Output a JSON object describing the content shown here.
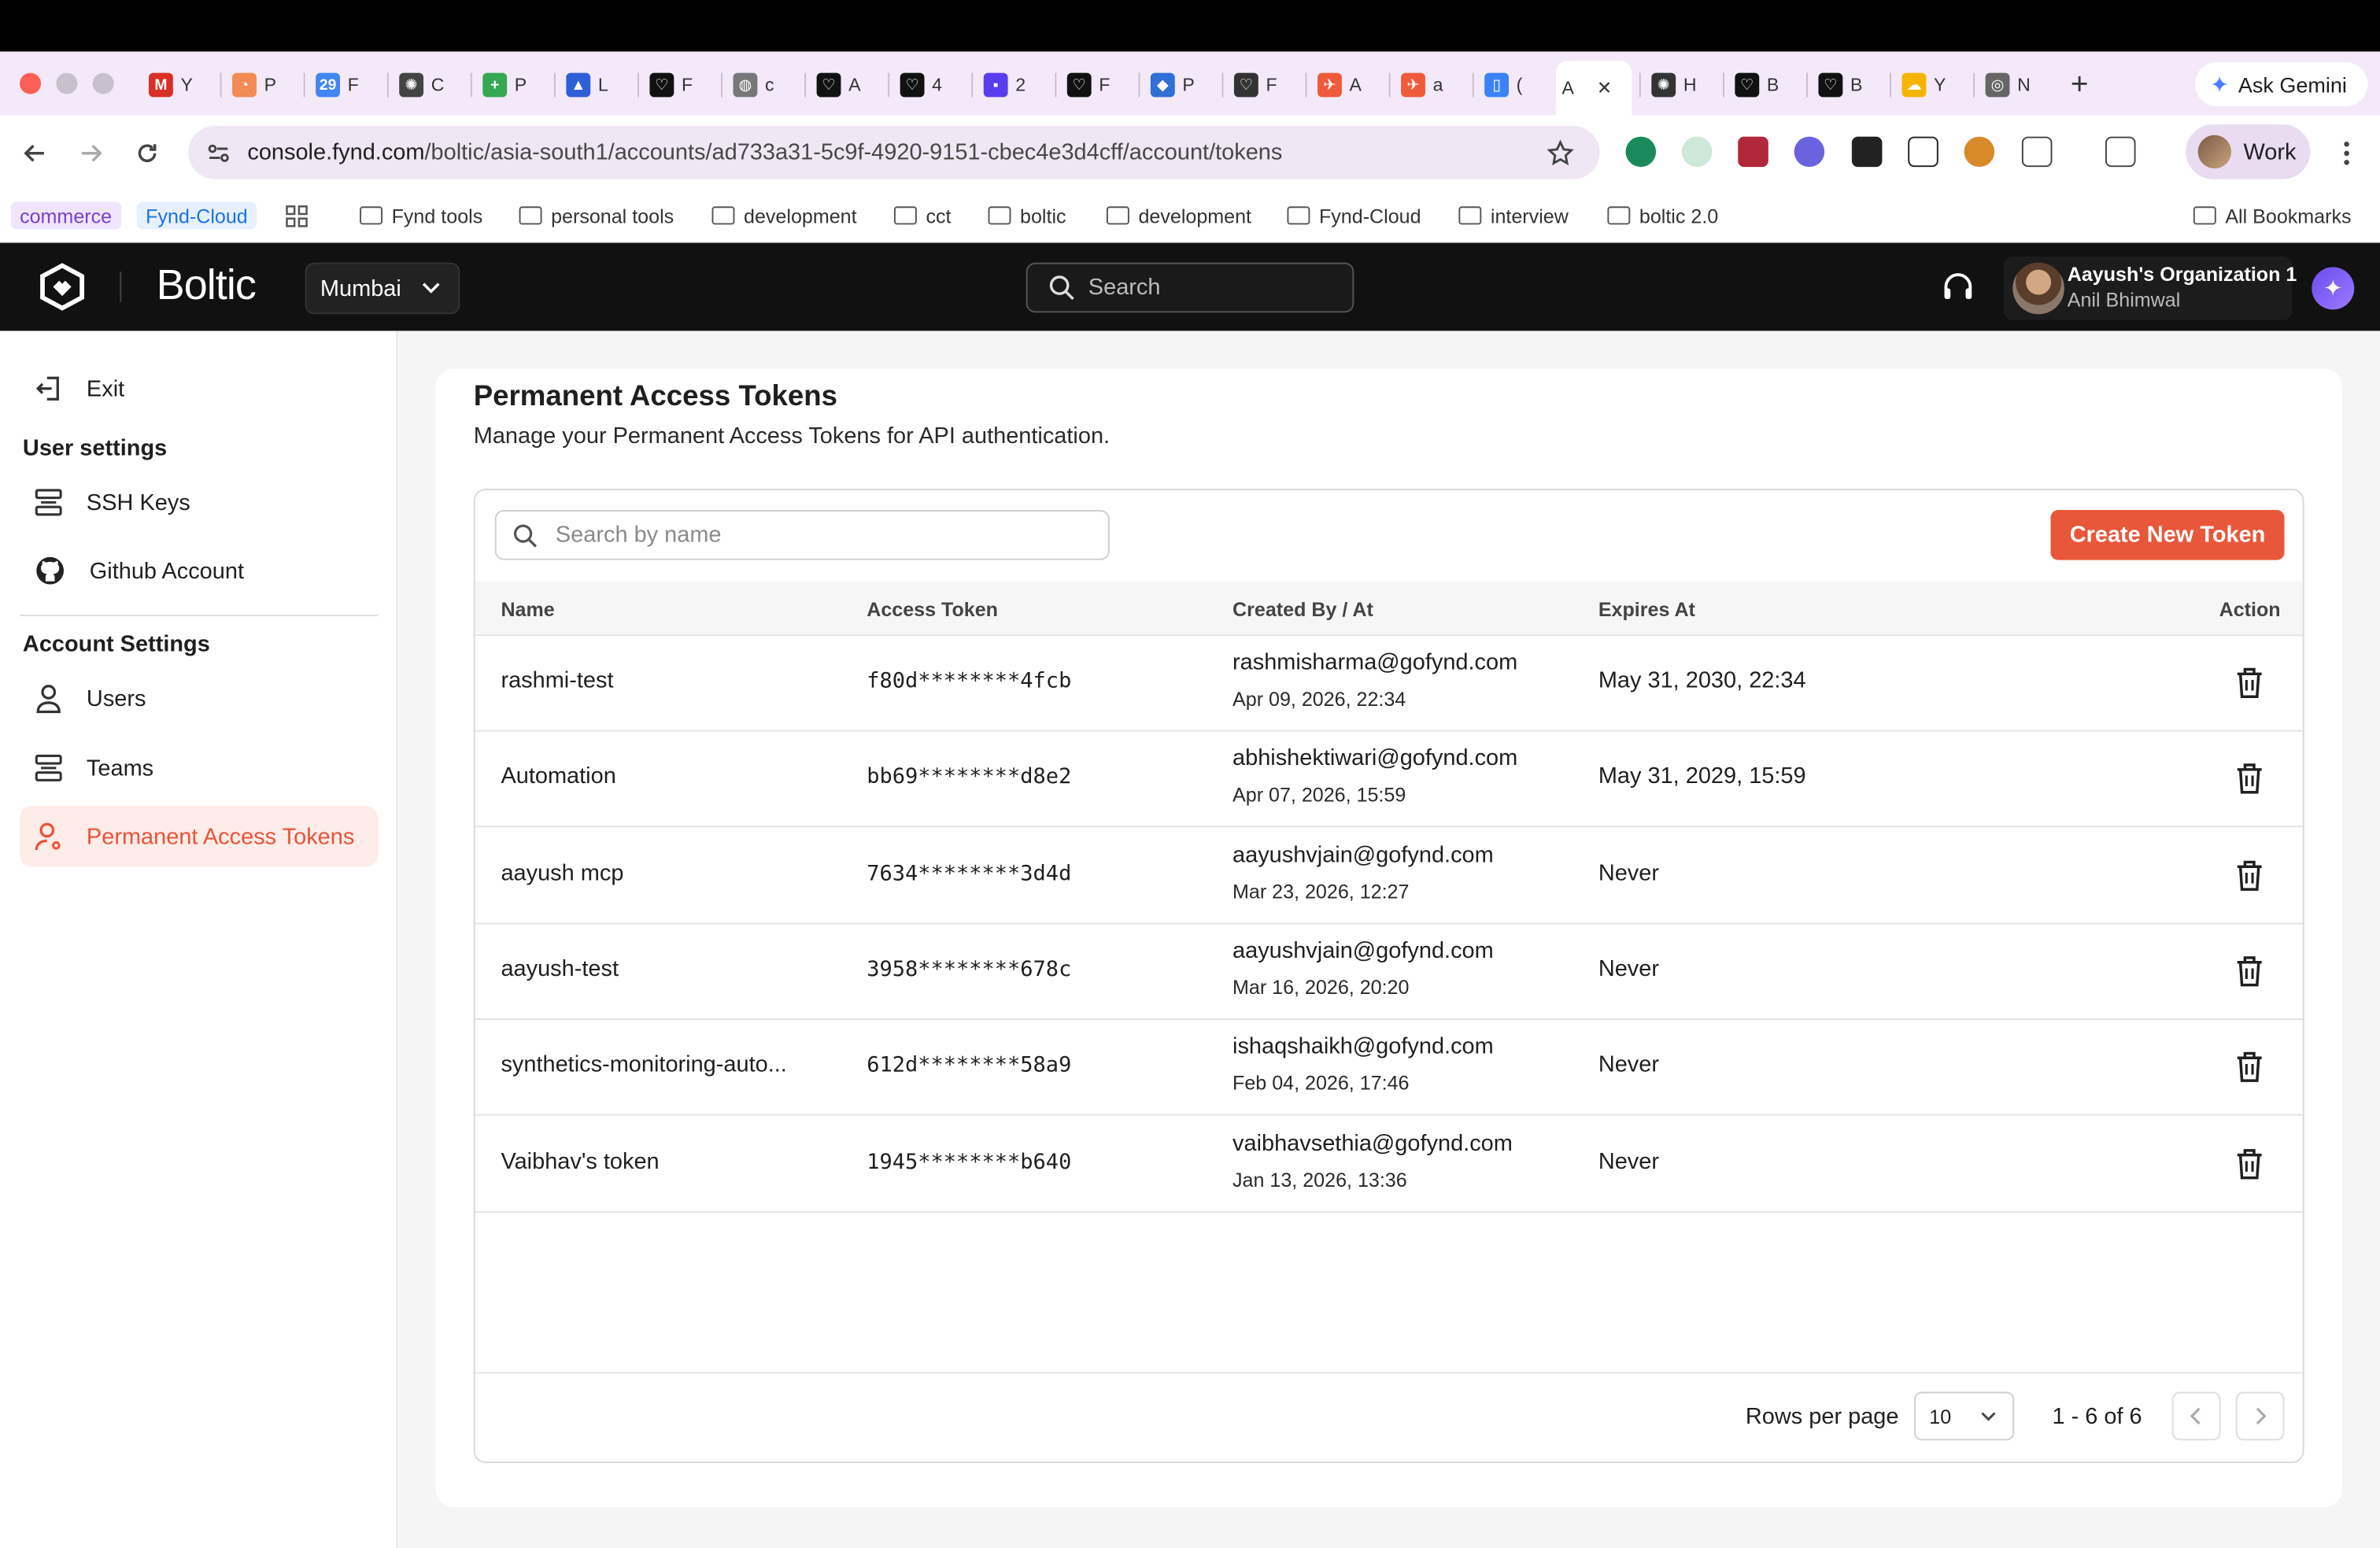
{
  "browser": {
    "tabs": [
      {
        "letter": "Y",
        "color": "#d93025",
        "icon": "gmail-icon",
        "glyph": "M"
      },
      {
        "letter": "P",
        "color": "#f28b54",
        "icon": "clock-icon",
        "glyph": "◔"
      },
      {
        "letter": "F",
        "color": "#4285f4",
        "icon": "calendar-icon",
        "glyph": "29"
      },
      {
        "letter": "C",
        "color": "#444444",
        "icon": "openai-icon",
        "glyph": "✺"
      },
      {
        "letter": "P",
        "color": "#34a853",
        "icon": "sheets-icon",
        "glyph": "+"
      },
      {
        "letter": "L",
        "color": "#2f5fd6",
        "icon": "atlassian-icon",
        "glyph": "▲"
      },
      {
        "letter": "F",
        "color": "#111111",
        "icon": "boltic-icon",
        "glyph": "♡"
      },
      {
        "letter": "c",
        "color": "#777777",
        "icon": "globe-icon",
        "glyph": "◍"
      },
      {
        "letter": "A",
        "color": "#111111",
        "icon": "boltic-icon",
        "glyph": "♡"
      },
      {
        "letter": "4",
        "color": "#111111",
        "icon": "boltic-icon",
        "glyph": "♡"
      },
      {
        "letter": "2",
        "color": "#5b3df0",
        "icon": "linear-icon",
        "glyph": "▪"
      },
      {
        "letter": "F",
        "color": "#111111",
        "icon": "boltic-icon",
        "glyph": "♡"
      },
      {
        "letter": "P",
        "color": "#2f6fd6",
        "icon": "azure-icon",
        "glyph": "◆"
      },
      {
        "letter": "F",
        "color": "#333333",
        "icon": "boltic-outline-icon",
        "glyph": "♡"
      },
      {
        "letter": "A",
        "color": "#ef5b3a",
        "icon": "postman-icon",
        "glyph": "✈"
      },
      {
        "letter": "a",
        "color": "#ef5b3a",
        "icon": "postman-icon",
        "glyph": "✈"
      },
      {
        "letter": "(",
        "color": "#3b82f6",
        "icon": "doc-icon",
        "glyph": "▯"
      },
      {
        "letter": "A",
        "color": "#ffffff",
        "icon": "active-tab-icon",
        "glyph": ""
      },
      {
        "letter": "H",
        "color": "#333333",
        "icon": "openai-icon",
        "glyph": "✺"
      },
      {
        "letter": "B",
        "color": "#111111",
        "icon": "boltic-icon",
        "glyph": "♡"
      },
      {
        "letter": "B",
        "color": "#111111",
        "icon": "boltic-icon",
        "glyph": "♡"
      },
      {
        "letter": "Y",
        "color": "#f4b400",
        "icon": "gcloud-icon",
        "glyph": "☁"
      },
      {
        "letter": "N",
        "color": "#666666",
        "icon": "chrome-icon",
        "glyph": "◎"
      }
    ],
    "gemini_label": "Ask Gemini",
    "url_host": "console.fynd.com",
    "url_path": "/boltic/asia-south1/accounts/ad733a31-5c9f-4920-9151-cbec4e3d4cff/account/tokens",
    "profile_label": "Work",
    "bookmarks": {
      "chip1": "commerce",
      "chip2": "Fynd-Cloud",
      "folders": [
        "Fynd tools",
        "personal tools",
        "development",
        "cct",
        "boltic",
        "development",
        "Fynd-Cloud",
        "interview",
        "boltic 2.0"
      ],
      "all": "All Bookmarks"
    },
    "colors": {
      "accent": "#e8573a",
      "chip1": "#7a3fd1",
      "chip2": "#1a73e8"
    }
  },
  "header": {
    "brand": "Boltic",
    "region": "Mumbai",
    "search_placeholder": "Search",
    "org_name": "Aayush's Organization 1",
    "user_name": "Anil Bhimwal"
  },
  "sidebar": {
    "exit": "Exit",
    "user_settings_heading": "User settings",
    "ssh_keys": "SSH Keys",
    "github_account": "Github Account",
    "account_settings_heading": "Account Settings",
    "users": "Users",
    "teams": "Teams",
    "permanent_tokens": "Permanent Access Tokens"
  },
  "page": {
    "title": "Permanent Access Tokens",
    "subtitle": "Manage your Permanent Access Tokens for API authentication.",
    "search_placeholder": "Search by name",
    "create_button": "Create New Token",
    "columns": {
      "name": "Name",
      "token": "Access Token",
      "created": "Created By / At",
      "expires": "Expires At",
      "action": "Action"
    },
    "rows": [
      {
        "name": "rashmi-test",
        "token": "f80d********4fcb",
        "email": "rashmisharma@gofynd.com",
        "created_at": "Apr 09, 2026, 22:34",
        "expires": "May 31, 2030, 22:34"
      },
      {
        "name": "Automation",
        "token": "bb69********d8e2",
        "email": "abhishektiwari@gofynd.com",
        "created_at": "Apr 07, 2026, 15:59",
        "expires": "May 31, 2029, 15:59"
      },
      {
        "name": "aayush mcp",
        "token": "7634********3d4d",
        "email": "aayushvjain@gofynd.com",
        "created_at": "Mar 23, 2026, 12:27",
        "expires": "Never"
      },
      {
        "name": "aayush-test",
        "token": "3958********678c",
        "email": "aayushvjain@gofynd.com",
        "created_at": "Mar 16, 2026, 20:20",
        "expires": "Never"
      },
      {
        "name": "synthetics-monitoring-auto...",
        "token": "612d********58a9",
        "email": "ishaqshaikh@gofynd.com",
        "created_at": "Feb 04, 2026, 17:46",
        "expires": "Never"
      },
      {
        "name": "Vaibhav's token",
        "token": "1945********b640",
        "email": "vaibhavsethia@gofynd.com",
        "created_at": "Jan 13, 2026, 13:36",
        "expires": "Never"
      }
    ],
    "footer": {
      "rows_per_page_label": "Rows per page",
      "rows_per_page_value": "10",
      "page_info": "1 - 6 of 6"
    }
  }
}
